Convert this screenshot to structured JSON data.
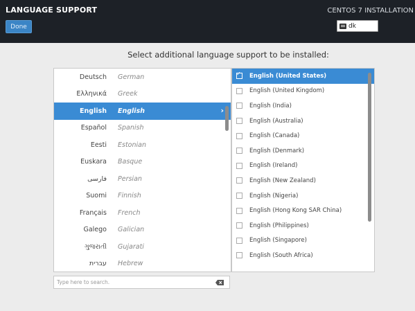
{
  "header": {
    "title": "LANGUAGE SUPPORT",
    "done_label": "Done",
    "install_title": "CENTOS 7 INSTALLATION",
    "keyboard_label": "dk"
  },
  "prompt": "Select additional language support to be installed:",
  "languages": [
    {
      "native": "Deutsch",
      "english": "German"
    },
    {
      "native": "Ελληνικά",
      "english": "Greek"
    },
    {
      "native": "English",
      "english": "English",
      "selected": true
    },
    {
      "native": "Español",
      "english": "Spanish"
    },
    {
      "native": "Eesti",
      "english": "Estonian"
    },
    {
      "native": "Euskara",
      "english": "Basque"
    },
    {
      "native": "فارسی",
      "english": "Persian"
    },
    {
      "native": "Suomi",
      "english": "Finnish"
    },
    {
      "native": "Français",
      "english": "French"
    },
    {
      "native": "Galego",
      "english": "Galician"
    },
    {
      "native": "ગુજરાતી",
      "english": "Gujarati"
    },
    {
      "native": "עברית",
      "english": "Hebrew"
    }
  ],
  "locales": [
    {
      "label": "English (United States)",
      "selected": true
    },
    {
      "label": "English (United Kingdom)"
    },
    {
      "label": "English (India)"
    },
    {
      "label": "English (Australia)"
    },
    {
      "label": "English (Canada)"
    },
    {
      "label": "English (Denmark)"
    },
    {
      "label": "English (Ireland)"
    },
    {
      "label": "English (New Zealand)"
    },
    {
      "label": "English (Nigeria)"
    },
    {
      "label": "English (Hong Kong SAR China)"
    },
    {
      "label": "English (Philippines)"
    },
    {
      "label": "English (Singapore)"
    },
    {
      "label": "English (South Africa)"
    }
  ],
  "search": {
    "placeholder": "Type here to search."
  },
  "icons": {
    "chevron": "chevron-right-icon",
    "clear": "clear-search-icon",
    "keyboard": "keyboard-icon"
  },
  "colors": {
    "header_bg": "#1d2127",
    "accent": "#3a8bd4",
    "background": "#ececec"
  }
}
